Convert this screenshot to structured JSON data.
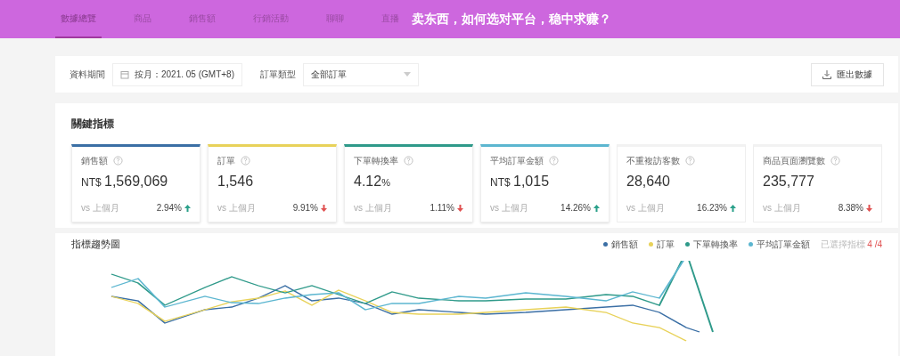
{
  "banner": {
    "title": "卖东西，如何选对平台，稳中求赚？"
  },
  "tabs": [
    {
      "label": "數據總覽",
      "selected": true
    },
    {
      "label": "商品",
      "selected": false
    },
    {
      "label": "銷售額",
      "selected": false
    },
    {
      "label": "行銷活動",
      "selected": false
    },
    {
      "label": "聊聊",
      "selected": false
    },
    {
      "label": "直播",
      "selected": false
    }
  ],
  "filters": {
    "period_label": "資料期間",
    "period_value": "按月：2021. 05 (GMT+8)",
    "order_type_label": "訂單類型",
    "order_type_value": "全部訂單",
    "export_button": "匯出數據"
  },
  "key_metrics": {
    "title": "關鍵指標",
    "cards": [
      {
        "label": "銷售額",
        "currency": "NT$",
        "value": "1,569,069",
        "compare": "vs 上個月",
        "change": "2.94%",
        "rising": true,
        "selected": true,
        "color": "#3b6fa5"
      },
      {
        "label": "訂單",
        "value": "1,546",
        "compare": "vs 上個月",
        "change": "9.91%",
        "rising": false,
        "selected": true,
        "color": "#e8d25a"
      },
      {
        "label": "下單轉換率",
        "value": "4.12",
        "unit": "%",
        "compare": "vs 上個月",
        "change": "1.11%",
        "rising": false,
        "selected": true,
        "color": "#2f9a8a"
      },
      {
        "label": "平均訂單金額",
        "currency": "NT$",
        "value": "1,015",
        "compare": "vs 上個月",
        "change": "14.26%",
        "rising": true,
        "selected": true,
        "color": "#5cb6d0"
      },
      {
        "label": "不重複訪客數",
        "value": "28,640",
        "compare": "vs 上個月",
        "change": "16.23%",
        "rising": true,
        "selected": false
      },
      {
        "label": "商品頁面瀏覽數",
        "value": "235,777",
        "compare": "vs 上個月",
        "change": "8.38%",
        "rising": false,
        "selected": false
      }
    ]
  },
  "trend_chart": {
    "title": "指標趨勢圖",
    "legend": [
      {
        "label": "銷售額",
        "color": "#3b6fa5"
      },
      {
        "label": "訂單",
        "color": "#e8d25a"
      },
      {
        "label": "下單轉換率",
        "color": "#2f9a8a"
      },
      {
        "label": "平均訂單金額",
        "color": "#5cb6d0"
      }
    ],
    "selected_label": "已選擇指標",
    "selected_count": "4 /4"
  }
}
